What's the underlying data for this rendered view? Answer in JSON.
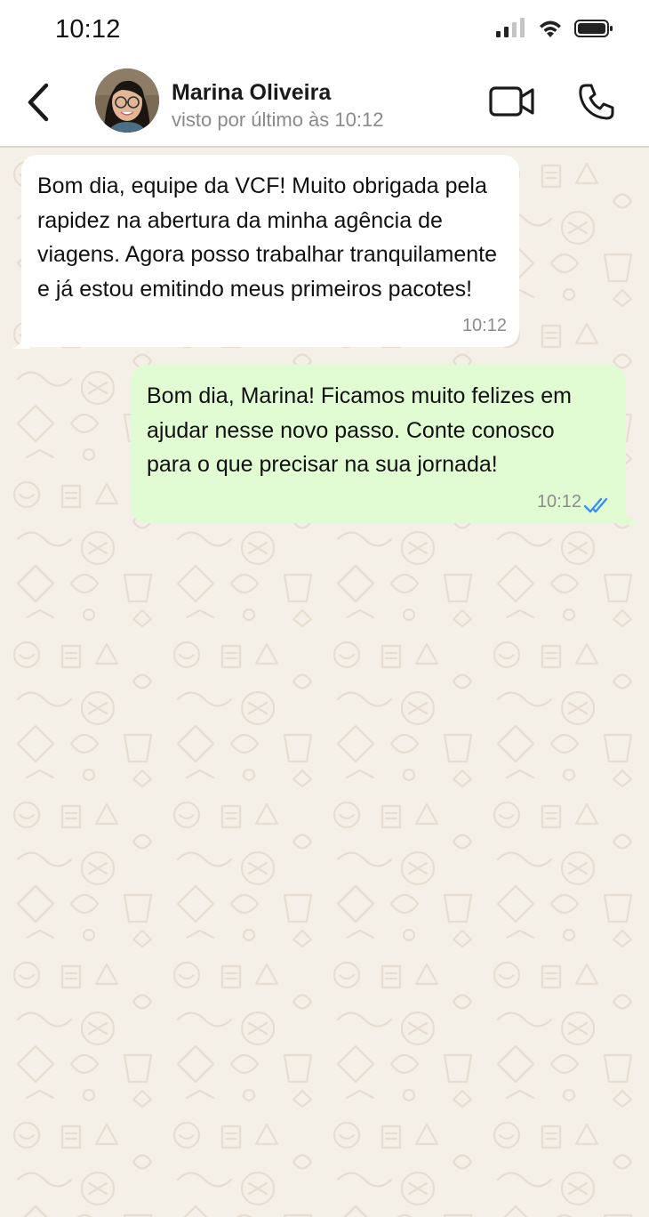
{
  "status_bar": {
    "time": "10:12",
    "icons": [
      "signal-icon",
      "wifi-icon",
      "battery-icon"
    ]
  },
  "header": {
    "contact_name": "Marina Oliveira",
    "last_seen": "visto por último às 10:12",
    "icons": [
      "back-arrow-icon",
      "video-call-icon",
      "phone-call-icon"
    ]
  },
  "messages": [
    {
      "direction": "incoming",
      "text": "Bom dia, equipe da VCF! Muito obrigada pela rapidez na abertura da minha agência de viagens. Agora posso trabalhar tranquilamente e já estou emitindo meus primeiros pacotes!",
      "time": "10:12"
    },
    {
      "direction": "outgoing",
      "text": "Bom dia, Marina! Ficamos muito felizes em ajudar nesse novo passo. Conte conosco para o que precisar na sua jornada!",
      "time": "10:12",
      "status": "read"
    }
  ],
  "colors": {
    "wallpaper": "#f4f0e8",
    "incoming_bubble": "#ffffff",
    "outgoing_bubble": "#e1fcd3",
    "read_ticks": "#3b8ff0"
  }
}
